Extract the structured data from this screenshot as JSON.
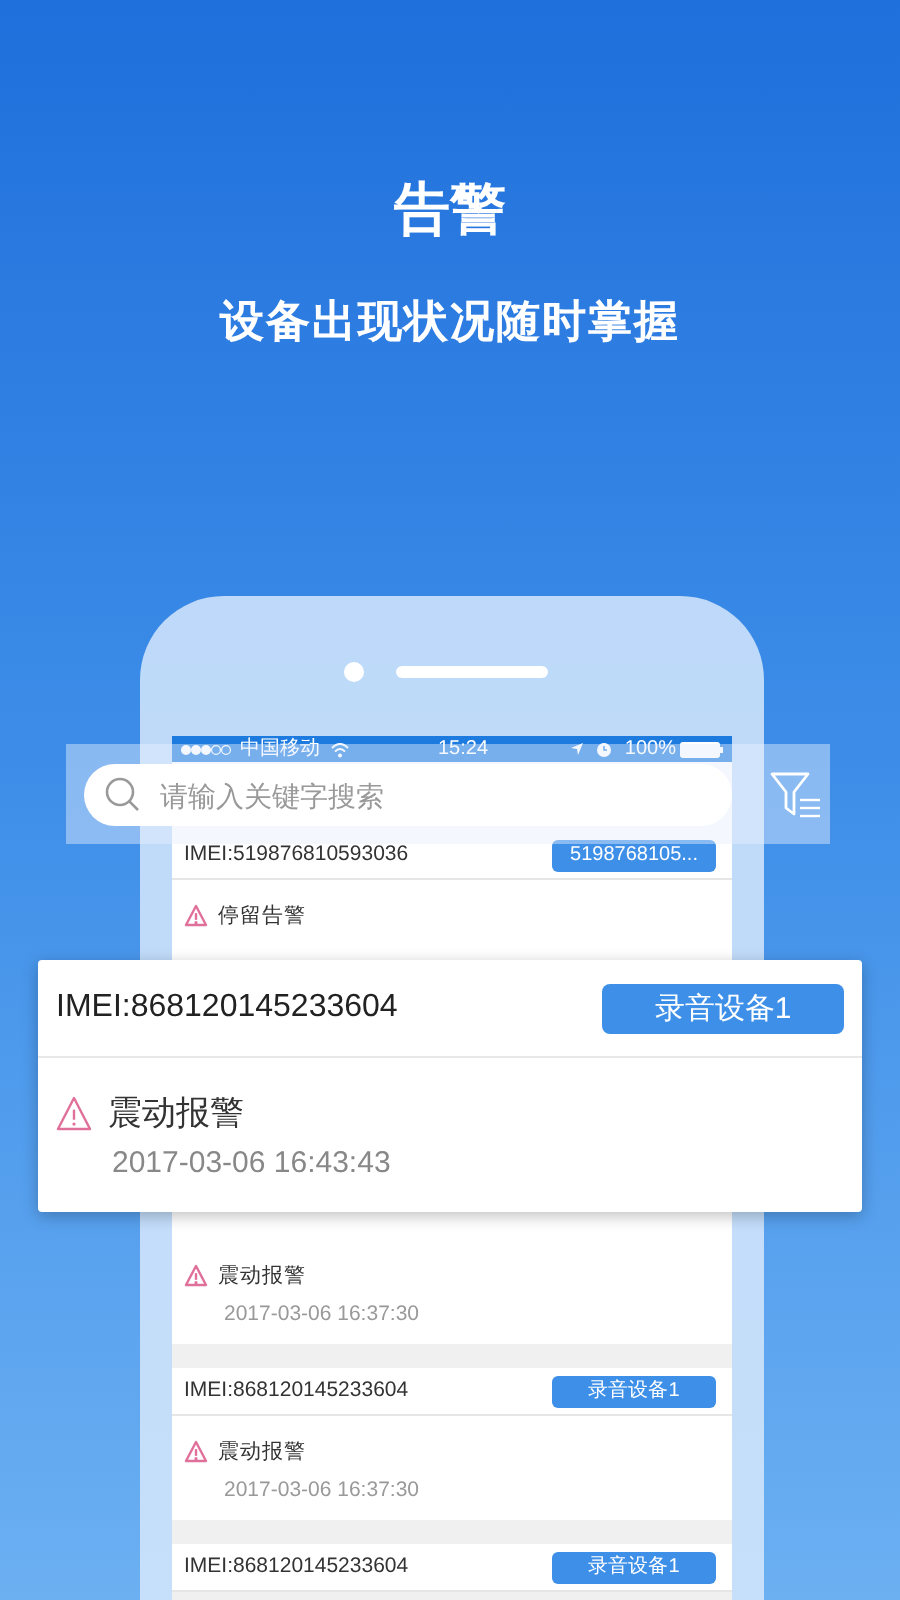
{
  "header": {
    "title": "告警",
    "subtitle": "设备出现状况随时掌握"
  },
  "status_bar": {
    "carrier": "中国移动",
    "time": "15:24",
    "battery": "100%"
  },
  "search": {
    "placeholder": "请输入关键字搜索"
  },
  "list_top": [
    {
      "kind": "device",
      "imei": "IMEI:519876810593036",
      "device": "5198768105..."
    },
    {
      "kind": "alarm",
      "title": "停留告警"
    }
  ],
  "list_bottom": [
    {
      "kind": "alarm",
      "title": "震动报警",
      "time": "2017-03-06 16:37:30"
    },
    {
      "kind": "device",
      "imei": "IMEI:868120145233604",
      "device": "录音设备1"
    },
    {
      "kind": "alarm",
      "title": "震动报警",
      "time": "2017-03-06 16:37:30"
    },
    {
      "kind": "device",
      "imei": "IMEI:868120145233604",
      "device": "录音设备1"
    }
  ],
  "callout": {
    "imei": "IMEI:868120145233604",
    "device": "录音设备1",
    "title": "震动报警",
    "time": "2017-03-06 16:43:43"
  }
}
